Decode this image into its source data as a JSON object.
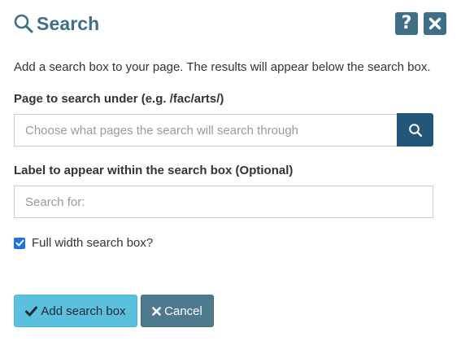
{
  "dialog": {
    "title": "Search",
    "intro": "Add a search box to your page. The results will appear below the search box.",
    "help_icon": "question-icon",
    "close_icon": "close-icon"
  },
  "page_field": {
    "label": "Page to search under (e.g. /fac/arts/)",
    "placeholder": "Choose what pages the search will search through",
    "value": ""
  },
  "label_field": {
    "label": "Label to appear within the search box (Optional)",
    "placeholder": "Search for:",
    "value": ""
  },
  "full_width": {
    "label": "Full width search box?",
    "checked": true
  },
  "actions": {
    "add_label": "Add search box",
    "cancel_label": "Cancel"
  },
  "colors": {
    "title": "#3e6f86",
    "header_buttons": "#3e6f86",
    "search_button": "#24567a",
    "add_button": "#5bc0de",
    "cancel_button": "#4d7a8f",
    "checkbox": "#1a73e8"
  }
}
